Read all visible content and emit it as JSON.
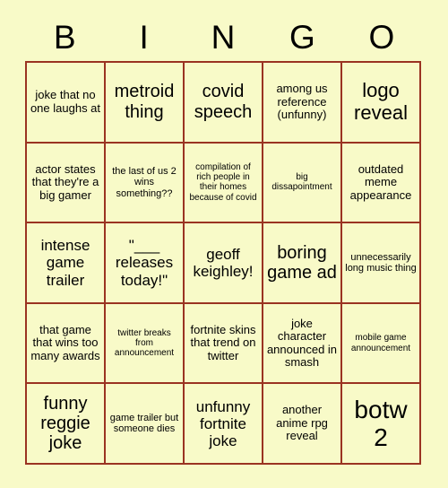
{
  "card": {
    "background_color": "#f8fac8",
    "border_color": "#9a3322",
    "text_color": "#000000",
    "header_letters": [
      "B",
      "I",
      "N",
      "G",
      "O"
    ],
    "rows": [
      [
        {
          "text": "joke that no one laughs at",
          "size": "sm"
        },
        {
          "text": "metroid thing",
          "size": "lg"
        },
        {
          "text": "covid speech",
          "size": "lg"
        },
        {
          "text": "among us reference (unfunny)",
          "size": "sm"
        },
        {
          "text": "logo reveal",
          "size": "xl"
        }
      ],
      [
        {
          "text": "actor states that they're a big gamer",
          "size": "sm"
        },
        {
          "text": "the last of us 2 wins something??",
          "size": "xs"
        },
        {
          "text": "compilation of rich people in their homes because of covid",
          "size": "xxs"
        },
        {
          "text": "big dissapointment",
          "size": "xxs"
        },
        {
          "text": "outdated meme appearance",
          "size": "sm"
        }
      ],
      [
        {
          "text": "intense game trailer",
          "size": "md"
        },
        {
          "text": "\"___ releases today!\"",
          "size": "md"
        },
        {
          "text": "geoff keighley!",
          "size": "md"
        },
        {
          "text": "boring game ad",
          "size": "lg"
        },
        {
          "text": "unnecessarily long music thing",
          "size": "xs"
        }
      ],
      [
        {
          "text": "that game that wins too many awards",
          "size": "sm"
        },
        {
          "text": "twitter breaks from announcement",
          "size": "xxs"
        },
        {
          "text": "fortnite skins that trend on twitter",
          "size": "sm"
        },
        {
          "text": "joke character announced in smash",
          "size": "sm"
        },
        {
          "text": "mobile game announcement",
          "size": "xxs"
        }
      ],
      [
        {
          "text": "funny reggie joke",
          "size": "lg"
        },
        {
          "text": "game trailer but someone dies",
          "size": "xs"
        },
        {
          "text": "unfunny fortnite joke",
          "size": "md"
        },
        {
          "text": "another anime rpg reveal",
          "size": "sm"
        },
        {
          "text": "botw 2",
          "size": "huge"
        }
      ]
    ]
  }
}
